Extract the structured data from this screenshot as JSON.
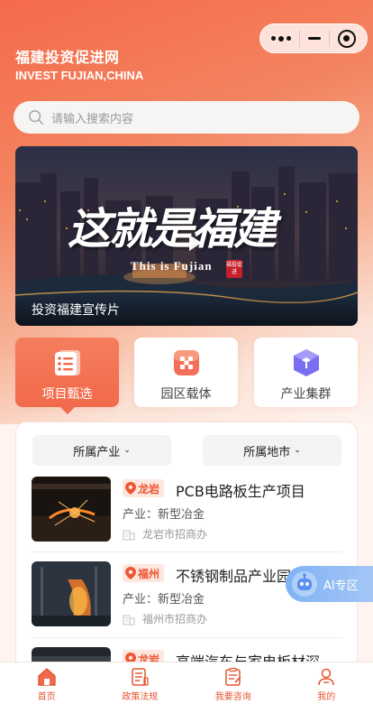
{
  "header": {
    "title": "福建投资促进网",
    "subtitle": "INVEST FUJIAN,CHINA"
  },
  "search": {
    "placeholder": "请输入搜索内容"
  },
  "banner": {
    "calligraphy": "这就是福建",
    "english": "This is Fujian",
    "seal_text": "福投促进",
    "caption": "投资福建宣传片"
  },
  "categories": [
    {
      "label": "项目甄选",
      "icon": "document-list-icon",
      "active": true
    },
    {
      "label": "园区载体",
      "icon": "park-grid-icon",
      "active": false
    },
    {
      "label": "产业集群",
      "icon": "cube-cluster-icon",
      "active": false
    }
  ],
  "filters": [
    {
      "label": "所属产业"
    },
    {
      "label": "所属地市"
    }
  ],
  "projects": [
    {
      "city": "龙岩",
      "title": "PCB电路板生产项目",
      "industry": "产业：新型冶金",
      "org": "龙岩市招商办"
    },
    {
      "city": "福州",
      "title": "不锈钢制品产业园",
      "industry": "产业：新型冶金",
      "org": "福州市招商办"
    },
    {
      "city": "龙岩",
      "title": "高端汽车与家电板材深",
      "industry": "",
      "org": ""
    }
  ],
  "ai_button": {
    "label": "AI专区"
  },
  "tabbar": [
    {
      "label": "首页",
      "icon": "home-icon"
    },
    {
      "label": "政策法规",
      "icon": "policy-document-icon"
    },
    {
      "label": "我要咨询",
      "icon": "consult-form-icon"
    },
    {
      "label": "我的",
      "icon": "user-icon"
    }
  ],
  "colors": {
    "accent": "#f16a4b",
    "tag_bg": "#fde7df",
    "ai_blue": "#7fb3f5"
  }
}
